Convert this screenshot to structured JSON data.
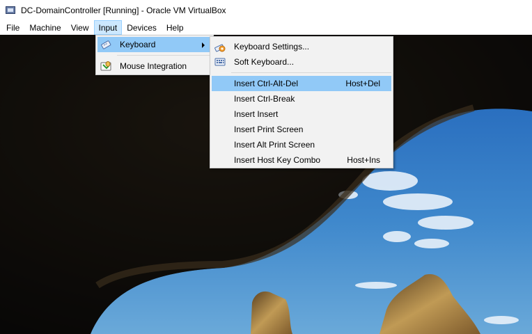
{
  "window": {
    "title": "DC-DomainController [Running] - Oracle VM VirtualBox",
    "icon": "virtualbox-app-icon"
  },
  "menubar": {
    "items": [
      "File",
      "Machine",
      "View",
      "Input",
      "Devices",
      "Help"
    ],
    "active": "Input"
  },
  "input_menu": {
    "items": [
      {
        "label": "Keyboard",
        "icon": "keyboard-pencil-icon",
        "has_submenu": true
      },
      {
        "label": "Mouse Integration",
        "icon": "mouse-integration-icon",
        "has_submenu": false
      }
    ]
  },
  "keyboard_submenu": {
    "top_items": [
      {
        "label": "Keyboard Settings...",
        "icon": "keyboard-settings-icon"
      },
      {
        "label": "Soft Keyboard...",
        "icon": "soft-keyboard-icon"
      }
    ],
    "commands": [
      {
        "label": "Insert Ctrl-Alt-Del",
        "shortcut": "Host+Del"
      },
      {
        "label": "Insert Ctrl-Break",
        "shortcut": ""
      },
      {
        "label": "Insert Insert",
        "shortcut": ""
      },
      {
        "label": "Insert Print Screen",
        "shortcut": ""
      },
      {
        "label": "Insert Alt Print Screen",
        "shortcut": ""
      },
      {
        "label": "Insert Host Key Combo",
        "shortcut": "Host+Ins"
      }
    ],
    "highlighted": "Insert Ctrl-Alt-Del"
  },
  "colors": {
    "menu_background": "#f2f2f2",
    "menu_highlight": "#91c9f7",
    "menubar_active": "#cce8ff",
    "sky": "#3f84c8",
    "cave": "#0b0a08"
  }
}
